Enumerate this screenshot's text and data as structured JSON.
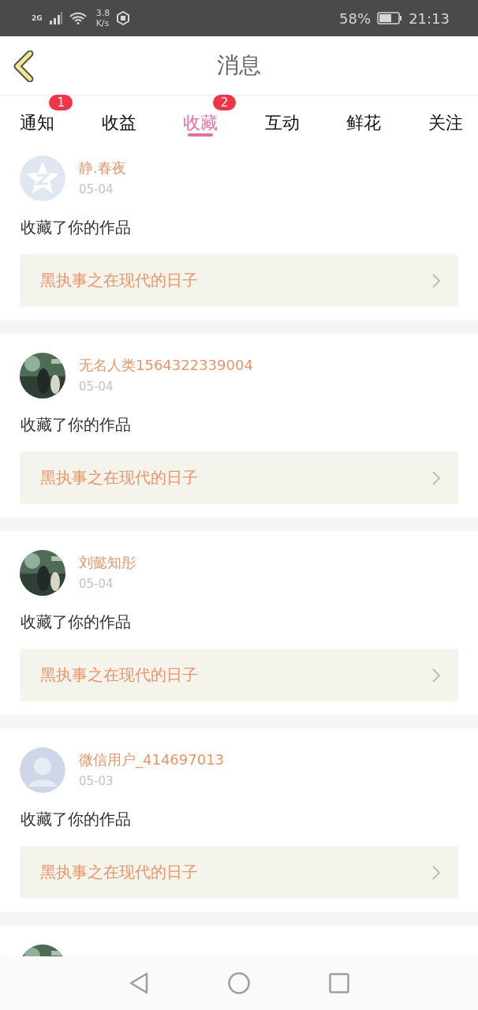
{
  "status_bar": {
    "network": "2G",
    "speed_value": "3.8",
    "speed_unit": "K/s",
    "battery": "58%",
    "time": "21:13"
  },
  "header": {
    "title": "消息"
  },
  "tabs": [
    {
      "label": "通知",
      "selected": false,
      "badge": "1"
    },
    {
      "label": "收益",
      "selected": false
    },
    {
      "label": "收藏",
      "selected": true,
      "badge": "2"
    },
    {
      "label": "互动",
      "selected": false
    },
    {
      "label": "鲜花",
      "selected": false
    },
    {
      "label": "关注",
      "selected": false
    }
  ],
  "messages": [
    {
      "avatar": {
        "kind": "star"
      },
      "name": "静.春夜",
      "date": "05-04",
      "action": "收藏了你的作品",
      "work": "黑执事之在现代的日子"
    },
    {
      "avatar": {
        "kind": "picture"
      },
      "name": "无名人类1564322339004",
      "date": "05-04",
      "action": "收藏了你的作品",
      "work": "黑执事之在现代的日子"
    },
    {
      "avatar": {
        "kind": "picture"
      },
      "name": "刘懿知彤",
      "date": "05-04",
      "action": "收藏了你的作品",
      "work": "黑执事之在现代的日子"
    },
    {
      "avatar": {
        "kind": "person"
      },
      "name": "微信用户_414697013",
      "date": "05-03",
      "action": "收藏了你的作品",
      "work": "黑执事之在现代的日子"
    },
    {
      "avatar": {
        "kind": "picture"
      }
    }
  ]
}
